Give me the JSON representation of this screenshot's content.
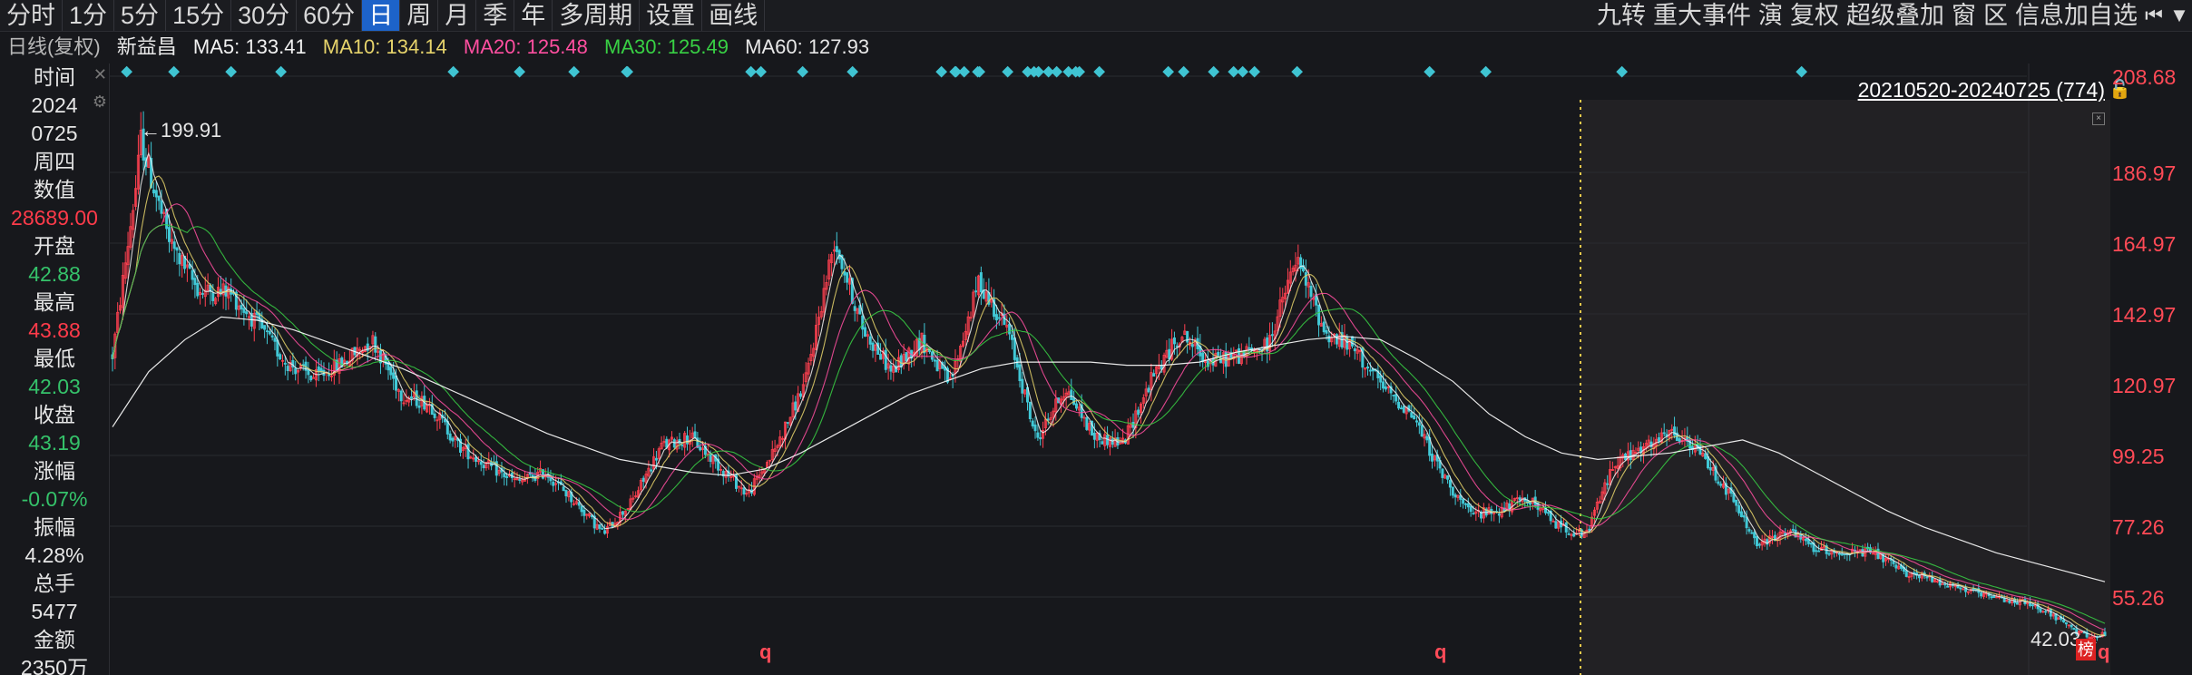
{
  "toolbar": {
    "tabs": [
      "分时",
      "1分",
      "5分",
      "15分",
      "30分",
      "60分",
      "日",
      "周",
      "月",
      "季",
      "年",
      "多周期",
      "设置",
      "画线"
    ],
    "active_tab": "日",
    "right_items": [
      "九转",
      "重大事件",
      "演",
      "复权",
      "超级叠加",
      "窗",
      "区",
      "信息加自选"
    ]
  },
  "legend": {
    "period_type": "日线(复权)",
    "stock_name": "新益昌",
    "ma5": "MA5: 133.41",
    "ma10": "MA10: 134.14",
    "ma20": "MA20: 125.48",
    "ma30": "MA30: 125.49",
    "ma60": "MA60: 127.93"
  },
  "info_panel": {
    "time_label": "时间",
    "date_year": "2024",
    "date_md": "0725",
    "weekday": "周四",
    "value_label": "数值",
    "value": "28689.00",
    "open_label": "开盘",
    "open": "42.88",
    "high_label": "最高",
    "high": "43.88",
    "low_label": "最低",
    "low": "42.03",
    "close_label": "收盘",
    "close": "43.19",
    "change_label": "涨幅",
    "change": "-0.07%",
    "amplitude_label": "振幅",
    "amplitude": "4.28%",
    "volume_label": "总手",
    "volume": "5477",
    "amount_label": "金额",
    "amount": "2350万"
  },
  "chart": {
    "range_label": "20210520-20240725 (774)",
    "high_marker": "199.91",
    "low_marker": "42.03",
    "end_badge": "榜",
    "q_marker": "q",
    "y_axis": [
      "208.68",
      "186.97",
      "164.97",
      "142.97",
      "120.97",
      "99.25",
      "77.26",
      "55.26"
    ],
    "colors": {
      "up": "#ff4050",
      "down": "#41c8d6",
      "ma5": "#f2f2f2",
      "ma10": "#e6d36b",
      "ma20": "#ff4fa0",
      "ma30": "#38d044",
      "ma60": "#ffffff",
      "grid": "#2a2b30",
      "marker": "#3fc4d2",
      "highlight_bg": "#222124",
      "period_line": "#e6c84a"
    }
  },
  "chart_data": {
    "type": "candlestick",
    "ylim": [
      40,
      215
    ],
    "y_ticks": [
      208.68,
      186.97,
      164.97,
      142.97,
      120.97,
      99.25,
      77.26,
      55.26
    ],
    "title": "",
    "xlabel": "",
    "ylabel": "",
    "trend_close": [
      130,
      195,
      165,
      150,
      150,
      140,
      128,
      123,
      128,
      135,
      118,
      115,
      102,
      96,
      91,
      94,
      85,
      75,
      85,
      102,
      105,
      96,
      87,
      102,
      122,
      166,
      138,
      125,
      135,
      121,
      153,
      138,
      104,
      120,
      105,
      103,
      123,
      137,
      128,
      130,
      133,
      160,
      137,
      132,
      120,
      112,
      94,
      81,
      82,
      86,
      78,
      74,
      97,
      101,
      106,
      100,
      87,
      71,
      76,
      70,
      69,
      69,
      63,
      61,
      58,
      55,
      54,
      51,
      44,
      43.19
    ],
    "ma60_trend": [
      108,
      125,
      135,
      142,
      141,
      138,
      134,
      130,
      126,
      121,
      116,
      111,
      106,
      102,
      98,
      96,
      94,
      93,
      95,
      100,
      106,
      112,
      118,
      122,
      126,
      128,
      128,
      128,
      127,
      127,
      128,
      131,
      133,
      135,
      136,
      135,
      129,
      122,
      112,
      105,
      100,
      98,
      99,
      100,
      102,
      104,
      100,
      94,
      88,
      82,
      77,
      73,
      69,
      66,
      63,
      60
    ]
  }
}
